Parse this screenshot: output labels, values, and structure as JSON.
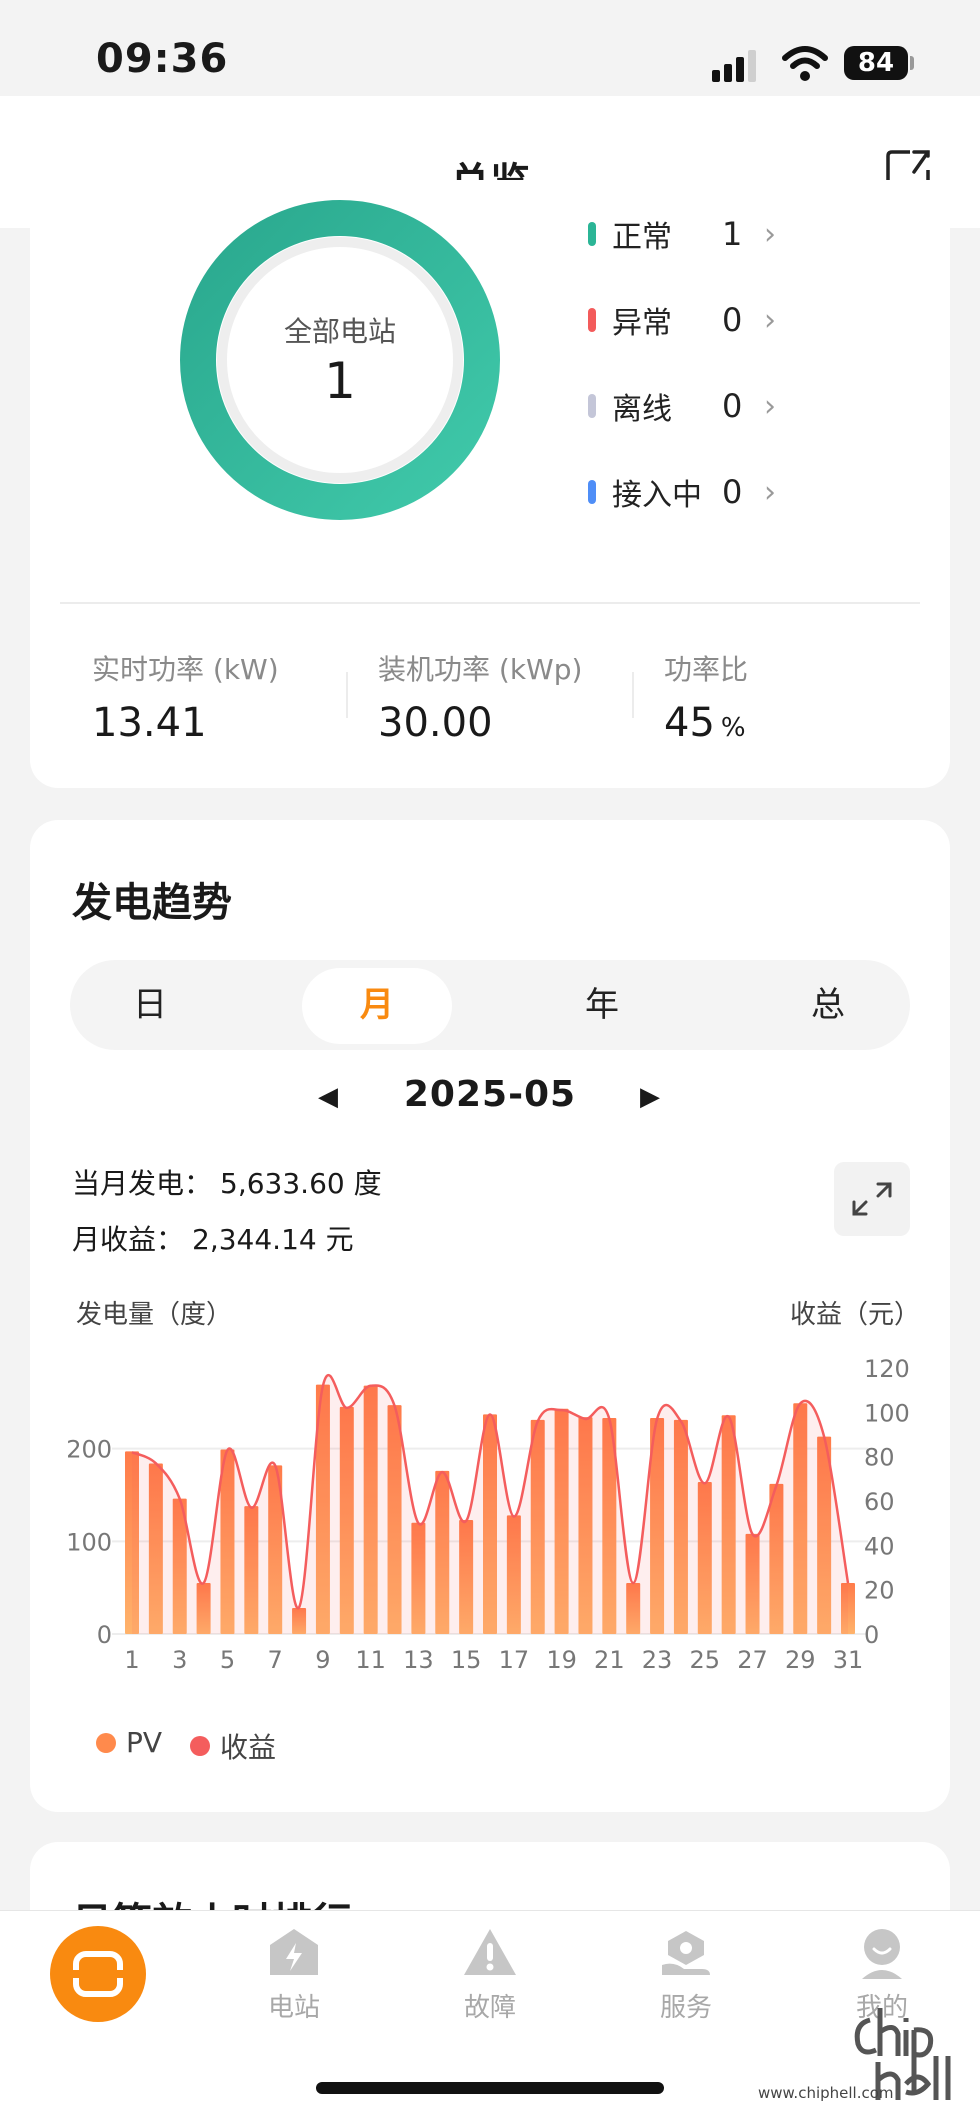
{
  "status_bar": {
    "time": "09:36",
    "battery": "84"
  },
  "header": {
    "title": "总览"
  },
  "overview": {
    "donut_label": "全部电站",
    "donut_count": "1",
    "status_items": [
      {
        "label": "正常",
        "count": "1",
        "color": "#2bb596"
      },
      {
        "label": "异常",
        "count": "0",
        "color": "#f35b5b"
      },
      {
        "label": "离线",
        "count": "0",
        "color": "#c4c6d8"
      },
      {
        "label": "接入中",
        "count": "0",
        "color": "#4f8ef7"
      }
    ],
    "metrics": [
      {
        "label": "实时功率 (kW)",
        "value": "13.41",
        "unit": ""
      },
      {
        "label": "装机功率 (kWp)",
        "value": "30.00",
        "unit": ""
      },
      {
        "label": "功率比",
        "value": "45",
        "unit": "%"
      }
    ]
  },
  "trend": {
    "title": "发电趋势",
    "tabs": [
      "日",
      "月",
      "年",
      "总"
    ],
    "active_tab": "月",
    "date": "2025-05",
    "month_generation_label": "当月发电：",
    "month_generation_value": "5,633.60 度",
    "month_income_label": "月收益：",
    "month_income_value": "2,344.14 元",
    "left_axis_title": "发电量（度）",
    "right_axis_title": "收益（元）"
  },
  "chart_data": {
    "type": "bar",
    "categories": [
      "1",
      "2",
      "3",
      "4",
      "5",
      "6",
      "7",
      "8",
      "9",
      "10",
      "11",
      "12",
      "13",
      "14",
      "15",
      "16",
      "17",
      "18",
      "19",
      "20",
      "21",
      "22",
      "23",
      "24",
      "25",
      "26",
      "27",
      "28",
      "29",
      "30",
      "31"
    ],
    "x_tick_labels": [
      "1",
      "3",
      "5",
      "7",
      "9",
      "11",
      "13",
      "15",
      "17",
      "19",
      "21",
      "23",
      "25",
      "27",
      "29",
      "31"
    ],
    "series": [
      {
        "name": "PV",
        "type": "bar",
        "axis": "left",
        "values": [
          197,
          184,
          146,
          55,
          199,
          138,
          182,
          28,
          269,
          245,
          268,
          247,
          120,
          176,
          123,
          237,
          128,
          231,
          243,
          234,
          233,
          55,
          233,
          231,
          164,
          236,
          108,
          162,
          249,
          213,
          55
        ]
      },
      {
        "name": "收益",
        "type": "line",
        "axis": "right",
        "values": [
          82,
          77,
          61,
          23,
          83,
          57,
          76,
          12,
          112,
          102,
          112,
          103,
          50,
          73,
          51,
          99,
          53,
          96,
          101,
          97,
          97,
          23,
          97,
          96,
          68,
          98,
          45,
          67,
          104,
          89,
          23
        ]
      }
    ],
    "left_axis": {
      "ticks": [
        "0",
        "100",
        "200"
      ],
      "ylim": [
        0,
        287
      ]
    },
    "right_axis": {
      "ticks": [
        "0",
        "20",
        "40",
        "60",
        "80",
        "100",
        "120"
      ],
      "ylim": [
        0,
        120
      ]
    },
    "grid": true,
    "legend": "bottom-left",
    "colors": {
      "bar_top": "#ff7b4a",
      "bar_bottom": "#ffb36b",
      "line": "#f45d5d"
    }
  },
  "legend": [
    {
      "label": "PV",
      "color": "#ff8a4c"
    },
    {
      "label": "收益",
      "color": "#f45d5d"
    }
  ],
  "next_card_title": "日等效小时排行",
  "bottom_nav": [
    {
      "label": "",
      "icon": "home-icon",
      "active": true
    },
    {
      "label": "电站",
      "icon": "station-icon"
    },
    {
      "label": "故障",
      "icon": "alert-icon"
    },
    {
      "label": "服务",
      "icon": "service-icon"
    },
    {
      "label": "我的",
      "icon": "profile-icon"
    }
  ],
  "watermark": {
    "text": "chip hell",
    "url": "www.chiphell.com"
  },
  "colors": {
    "accent": "#f98a10",
    "donut": "#2bb596"
  }
}
